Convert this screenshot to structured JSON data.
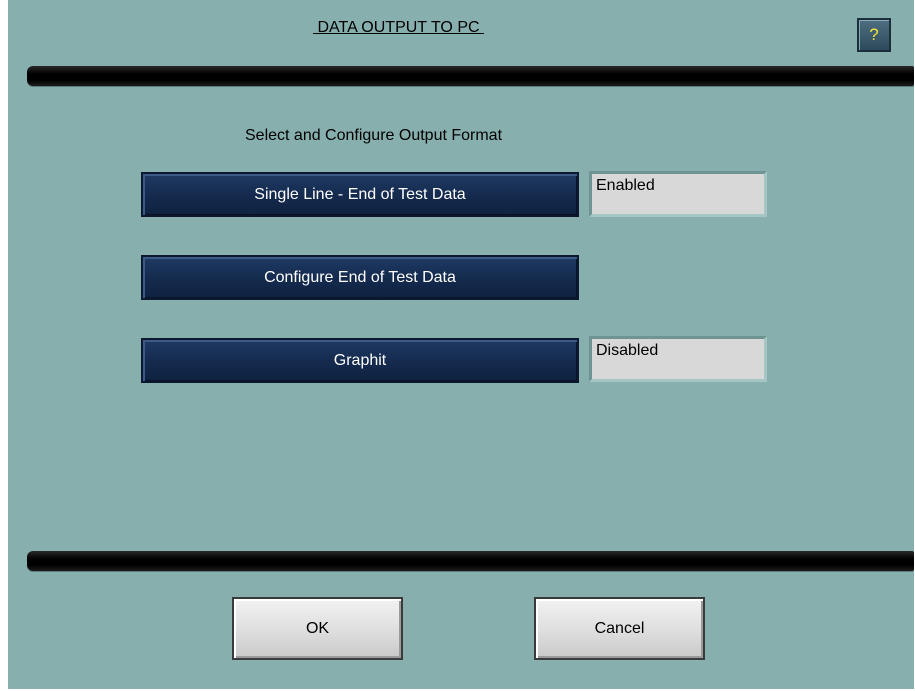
{
  "dialog": {
    "title": " DATA OUTPUT TO PC ",
    "help_label": "?",
    "subtitle": "Select and Configure Output Format"
  },
  "options": [
    {
      "label": "Single Line - End of Test Data",
      "status": "Enabled"
    },
    {
      "label": "Configure End of Test Data"
    },
    {
      "label": "Graphit",
      "status": "Disabled"
    }
  ],
  "footer": {
    "ok_label": "OK",
    "cancel_label": "Cancel"
  },
  "colors": {
    "background": "#86afae",
    "button_navy": "#142a4d",
    "status_field": "#d8d8d8",
    "help_question_mark": "#f2e43a"
  }
}
